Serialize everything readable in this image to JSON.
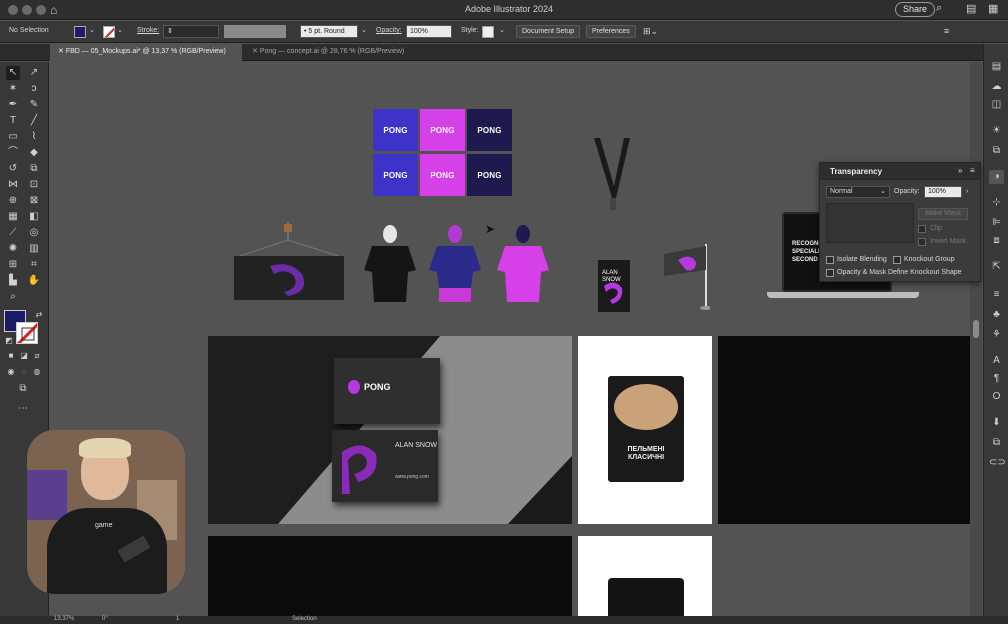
{
  "app": {
    "title": "Adobe Illustrator 2024",
    "share_label": "Share"
  },
  "control_bar": {
    "selection_label": "No Selection",
    "stroke_label": "Stroke:",
    "brush_value": "5 pt. Round",
    "opacity_label": "Opacity:",
    "opacity_value": "100%",
    "style_label": "Style:",
    "document_setup": "Document Setup",
    "preferences": "Preferences"
  },
  "tabs": [
    {
      "label": "FBD — 05_Mockups.ai* @ 13,37 % (RGB/Preview)",
      "active": true
    },
    {
      "label": "Pong — concept.ai @ 28,76 % (RGB/Preview)",
      "active": false
    }
  ],
  "artboards": {
    "logo_text": "PONG",
    "card_colors": [
      "#3d33c9",
      "#d640e8",
      "#1c1a4e",
      "#3d33c9",
      "#d640e8",
      "#1c1a4e"
    ],
    "badge_name": "ALAN SNOW",
    "laptop_text": "RECOGNI SPECIALI SECOND",
    "business_card_brand": "PONG",
    "business_card_name": "ALAN SNOW",
    "business_card_site": "www.pong.com",
    "package_title": "ПЕЛЬМЕНІ КЛАСИЧНІ",
    "webcam_shirt_text": "game"
  },
  "transparency_panel": {
    "title": "Transparency",
    "blend_mode": "Normal",
    "opacity_label": "Opacity:",
    "opacity_value": "100%",
    "make_mask": "Make Mask",
    "clip": "Clip",
    "invert_mask": "Invert Mask",
    "isolate_blending": "Isolate Blending",
    "knockout_group": "Knockout Group",
    "opacity_mask_define": "Opacity & Mask Define Knockout Shape"
  },
  "status_bar": {
    "zoom": "13,37%",
    "rotation": "0°",
    "artboard": "1",
    "tool": "Selection"
  },
  "colors": {
    "brand_blue": "#3d33c9",
    "brand_magenta": "#d640e8",
    "brand_navy": "#1c1a4e",
    "fill_color": "#1b1b66"
  }
}
